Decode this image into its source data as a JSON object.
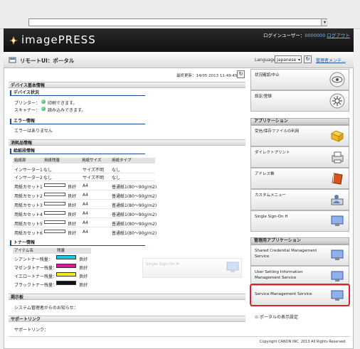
{
  "browser": {
    "url_value": ""
  },
  "header": {
    "brand": "imagePRESS",
    "login_prefix": "ログインユーザー：",
    "login_user": "0000000",
    "logout": "ログアウト"
  },
  "subbar": {
    "title": "リモートUI：ポータル",
    "language_label": "Language",
    "language_value": "Japanese",
    "admin_mode": "管理者メンテ..."
  },
  "main": {
    "last_updated": "最終更新：14/05 2013 11:49:45",
    "device_basic_info": "デバイス基本情報",
    "device_status": "デバイス状況",
    "printer_label": "プリンター：",
    "printer_status": "印刷できます。",
    "scanner_label": "スキャナー：",
    "scanner_status": "読み込みできます。",
    "error_info": "エラー情報",
    "error_text": "エラーはありません",
    "consumables_info": "消耗品情報",
    "paper_info": "給紙段情報",
    "paper_columns": [
      "給紙部",
      "用紙残量",
      "用紙サイズ",
      "用紙タイプ"
    ],
    "paper_rows": [
      {
        "name": "インサーター1",
        "level": "なし",
        "size": "サイズ不明",
        "type": "なし"
      },
      {
        "name": "インサーター2",
        "level": "なし",
        "size": "サイズ不明",
        "type": "なし"
      },
      {
        "name": "用紙カセット1",
        "level": "良好",
        "size": "A4",
        "type": "普通紙1(80〜90g/m2)"
      },
      {
        "name": "用紙カセット2",
        "level": "良好",
        "size": "A4",
        "type": "普通紙1(80〜90g/m2)"
      },
      {
        "name": "用紙カセット3",
        "level": "良好",
        "size": "A4",
        "type": "普通紙1(80〜90g/m2)"
      },
      {
        "name": "用紙カセット4",
        "level": "良好",
        "size": "A4",
        "type": "普通紙1(80〜90g/m2)"
      },
      {
        "name": "用紙カセット5",
        "level": "良好",
        "size": "A4",
        "type": "普通紙1(80〜90g/m2)"
      },
      {
        "name": "用紙カセット6",
        "level": "良好",
        "size": "A4",
        "type": "普通紙1(80〜90g/m2)"
      }
    ],
    "toner_info": "トナー情報",
    "toner_columns": [
      "アイテム名",
      "残量"
    ],
    "toner_rows": [
      {
        "name": "シアントナー残量：",
        "status": "良好",
        "color": "#19c8e8"
      },
      {
        "name": "マゼンタトナー残量：",
        "status": "良好",
        "color": "#e0189a"
      },
      {
        "name": "イエロートナー残量：",
        "status": "良好",
        "color": "#f2ec1a"
      },
      {
        "name": "ブラックトナー残量：",
        "status": "良好",
        "color": "#111111"
      }
    ],
    "messages_head": "掲示板",
    "messages_text": "システム管理者からのお知らせ：",
    "support_head": "サポートリンク",
    "support_text": "サポートリンク：",
    "sso_ghost": "Single Sign-On H"
  },
  "right": {
    "status_btn": "状況確認/中止",
    "settings_btn": "設定/登録",
    "apps_head": "アプリケーション",
    "app_items": [
      "受信/保存ファイルの利用",
      "ダイレクトプリント",
      "アドレス帳",
      "カスタムメニュー",
      "Single Sign-On H"
    ],
    "mgmt_head": "管理用アプリケーション",
    "mgmt_items": [
      "Shared Credential Management Service",
      "User Setting Information Management Service",
      "Service Management Service"
    ],
    "portal_settings": "ポータルの表示設定"
  },
  "footer": {
    "copyright": "Copyright CANON INC. 2013 All Rights Reserved"
  },
  "colors": {
    "accent": "#1b4a9a",
    "highlight": "#e0202a",
    "status_ok": "#1f9a43"
  }
}
